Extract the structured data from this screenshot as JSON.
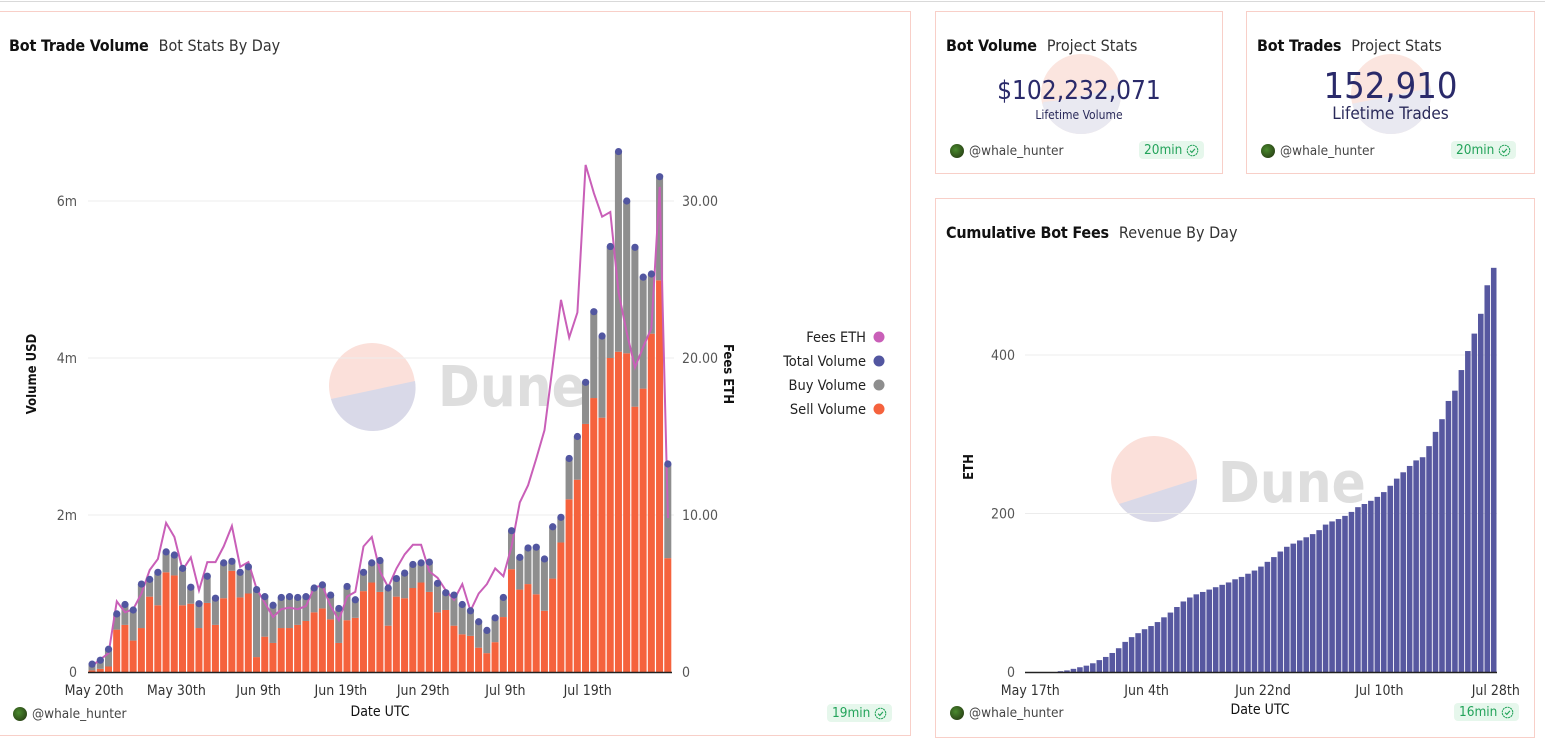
{
  "colors": {
    "fees": "#c95fb8",
    "total": "#5256a0",
    "buy": "#8e8e8e",
    "sell": "#f5623d",
    "cumulative": "#5758a0",
    "badge_text": "#23a35a",
    "card_border": "#f8cfc8"
  },
  "watermark": {
    "text": "Dune"
  },
  "cards": {
    "trade_volume": {
      "title": "Bot Trade Volume",
      "subtitle": "Bot Stats By Day",
      "owner": "@whale_hunter",
      "refresh": "19min",
      "legend": [
        {
          "label": "Fees ETH",
          "color": "#c95fb8"
        },
        {
          "label": "Total Volume",
          "color": "#5256a0"
        },
        {
          "label": "Buy Volume",
          "color": "#8e8e8e"
        },
        {
          "label": "Sell Volume",
          "color": "#f5623d"
        }
      ]
    },
    "bot_volume": {
      "title": "Bot Volume",
      "subtitle": "Project Stats",
      "value": "$102,232,071",
      "label": "Lifetime Volume",
      "owner": "@whale_hunter",
      "refresh": "20min"
    },
    "bot_trades": {
      "title": "Bot Trades",
      "subtitle": "Project Stats",
      "value": "152,910",
      "label": "Lifetime Trades",
      "owner": "@whale_hunter",
      "refresh": "20min"
    },
    "cumulative_fees": {
      "title": "Cumulative Bot Fees",
      "subtitle": "Revenue By Day",
      "owner": "@whale_hunter",
      "refresh": "16min"
    }
  },
  "chart_data": [
    {
      "type": "bar",
      "stacked": true,
      "title": "Bot Trade Volume",
      "xlabel": "Date UTC",
      "ylabel": "Volume USD",
      "y2label": "Fees ETH",
      "x_ticks": [
        "May 20th",
        "May 30th",
        "Jun 9th",
        "Jun 19th",
        "Jun 29th",
        "Jul 9th",
        "Jul 19th"
      ],
      "y_ticks": [
        "0",
        "2m",
        "4m",
        "6m"
      ],
      "y2_ticks": [
        "0",
        "10.00",
        "20.00",
        "30.00"
      ],
      "ylim": [
        0,
        6000000
      ],
      "y2lim": [
        0,
        30
      ],
      "grid": true,
      "legend_position": "right",
      "series": [
        {
          "name": "Sell Volume",
          "type": "bar",
          "values": [
            20000,
            40000,
            70000,
            540000,
            600000,
            400000,
            560000,
            960000,
            850000,
            1270000,
            1230000,
            850000,
            870000,
            560000,
            880000,
            600000,
            940000,
            1290000,
            950000,
            1000000,
            190000,
            450000,
            370000,
            560000,
            560000,
            600000,
            650000,
            760000,
            810000,
            670000,
            370000,
            660000,
            690000,
            1030000,
            1140000,
            1020000,
            590000,
            960000,
            940000,
            1070000,
            1140000,
            1020000,
            760000,
            790000,
            590000,
            480000,
            460000,
            310000,
            240000,
            380000,
            700000,
            1310000,
            1050000,
            1120000,
            990000,
            780000,
            1190000,
            1650000,
            2200000,
            2450000,
            3160000,
            3490000,
            3240000,
            4000000,
            4080000,
            4060000,
            3380000,
            3610000,
            4310000,
            4990000,
            1450000
          ]
        },
        {
          "name": "Buy Volume",
          "type": "bar",
          "values": [
            80000,
            110000,
            220000,
            200000,
            260000,
            390000,
            560000,
            220000,
            420000,
            260000,
            260000,
            470000,
            210000,
            310000,
            340000,
            340000,
            450000,
            120000,
            320000,
            340000,
            860000,
            510000,
            480000,
            390000,
            400000,
            350000,
            310000,
            310000,
            300000,
            310000,
            440000,
            430000,
            230000,
            240000,
            250000,
            400000,
            480000,
            230000,
            320000,
            300000,
            250000,
            380000,
            370000,
            220000,
            390000,
            380000,
            320000,
            330000,
            290000,
            310000,
            250000,
            490000,
            410000,
            460000,
            600000,
            660000,
            660000,
            320000,
            520000,
            550000,
            530000,
            1100000,
            1040000,
            1420000,
            2550000,
            1940000,
            2030000,
            1420000,
            760000,
            1320000,
            1200000
          ]
        },
        {
          "name": "Total Volume",
          "type": "scatter",
          "values": [
            100000,
            150000,
            290000,
            740000,
            860000,
            790000,
            1120000,
            1180000,
            1270000,
            1530000,
            1490000,
            1320000,
            1080000,
            870000,
            1220000,
            940000,
            1390000,
            1410000,
            1270000,
            1340000,
            1050000,
            960000,
            850000,
            950000,
            960000,
            950000,
            960000,
            1070000,
            1110000,
            980000,
            810000,
            1090000,
            920000,
            1270000,
            1390000,
            1420000,
            1070000,
            1190000,
            1260000,
            1370000,
            1390000,
            1400000,
            1130000,
            1010000,
            980000,
            860000,
            780000,
            640000,
            530000,
            690000,
            950000,
            1800000,
            1460000,
            1580000,
            1590000,
            1440000,
            1850000,
            1970000,
            2720000,
            3000000,
            3690000,
            4590000,
            4280000,
            5420000,
            6630000,
            6000000,
            5410000,
            5030000,
            5070000,
            6310000,
            2650000
          ]
        },
        {
          "name": "Fees ETH",
          "type": "line",
          "values": [
            0.4,
            0.8,
            1.2,
            4.5,
            3.8,
            4.0,
            5.0,
            6.5,
            7.2,
            9.5,
            8.6,
            6.5,
            7.3,
            5.2,
            7.0,
            7.0,
            8.0,
            9.3,
            6.7,
            7.0,
            5.3,
            4.4,
            3.5,
            4.0,
            4.1,
            4.0,
            4.2,
            5.4,
            5.5,
            4.2,
            3.3,
            4.8,
            5.1,
            8.0,
            8.6,
            6.4,
            5.4,
            6.6,
            7.5,
            8.1,
            8.1,
            6.4,
            6.0,
            5.2,
            4.6,
            5.6,
            3.9,
            5.0,
            5.6,
            6.6,
            6.1,
            8.0,
            10.8,
            11.9,
            13.6,
            15.4,
            19.5,
            23.7,
            21.3,
            22.9,
            32.3,
            30.5,
            29.0,
            29.3,
            24.2,
            21.6,
            19.4,
            20.7,
            21.9,
            30.9,
            9.8
          ]
        }
      ]
    },
    {
      "type": "bar",
      "title": "Cumulative Bot Fees",
      "xlabel": "Date UTC",
      "ylabel": "ETH",
      "x_ticks": [
        "May 17th",
        "Jun 4th",
        "Jun 22nd",
        "Jul 10th",
        "Jul 28th"
      ],
      "y_ticks": [
        "0",
        "200",
        "400"
      ],
      "ylim": [
        0,
        520
      ],
      "grid": true,
      "series": [
        {
          "name": "ETH",
          "values": [
            0,
            0,
            0,
            0,
            0,
            1,
            2,
            4,
            6,
            8,
            11,
            15,
            19,
            24,
            30,
            38,
            44,
            49,
            54,
            58,
            63,
            69,
            75,
            82,
            89,
            94,
            98,
            101,
            104,
            107,
            110,
            113,
            117,
            120,
            124,
            128,
            133,
            139,
            145,
            152,
            158,
            162,
            166,
            170,
            174,
            179,
            186,
            190,
            193,
            197,
            202,
            208,
            212,
            216,
            221,
            227,
            235,
            244,
            252,
            260,
            267,
            271,
            285,
            303,
            319,
            342,
            355,
            381,
            405,
            427,
            452,
            488,
            510
          ]
        }
      ]
    }
  ]
}
